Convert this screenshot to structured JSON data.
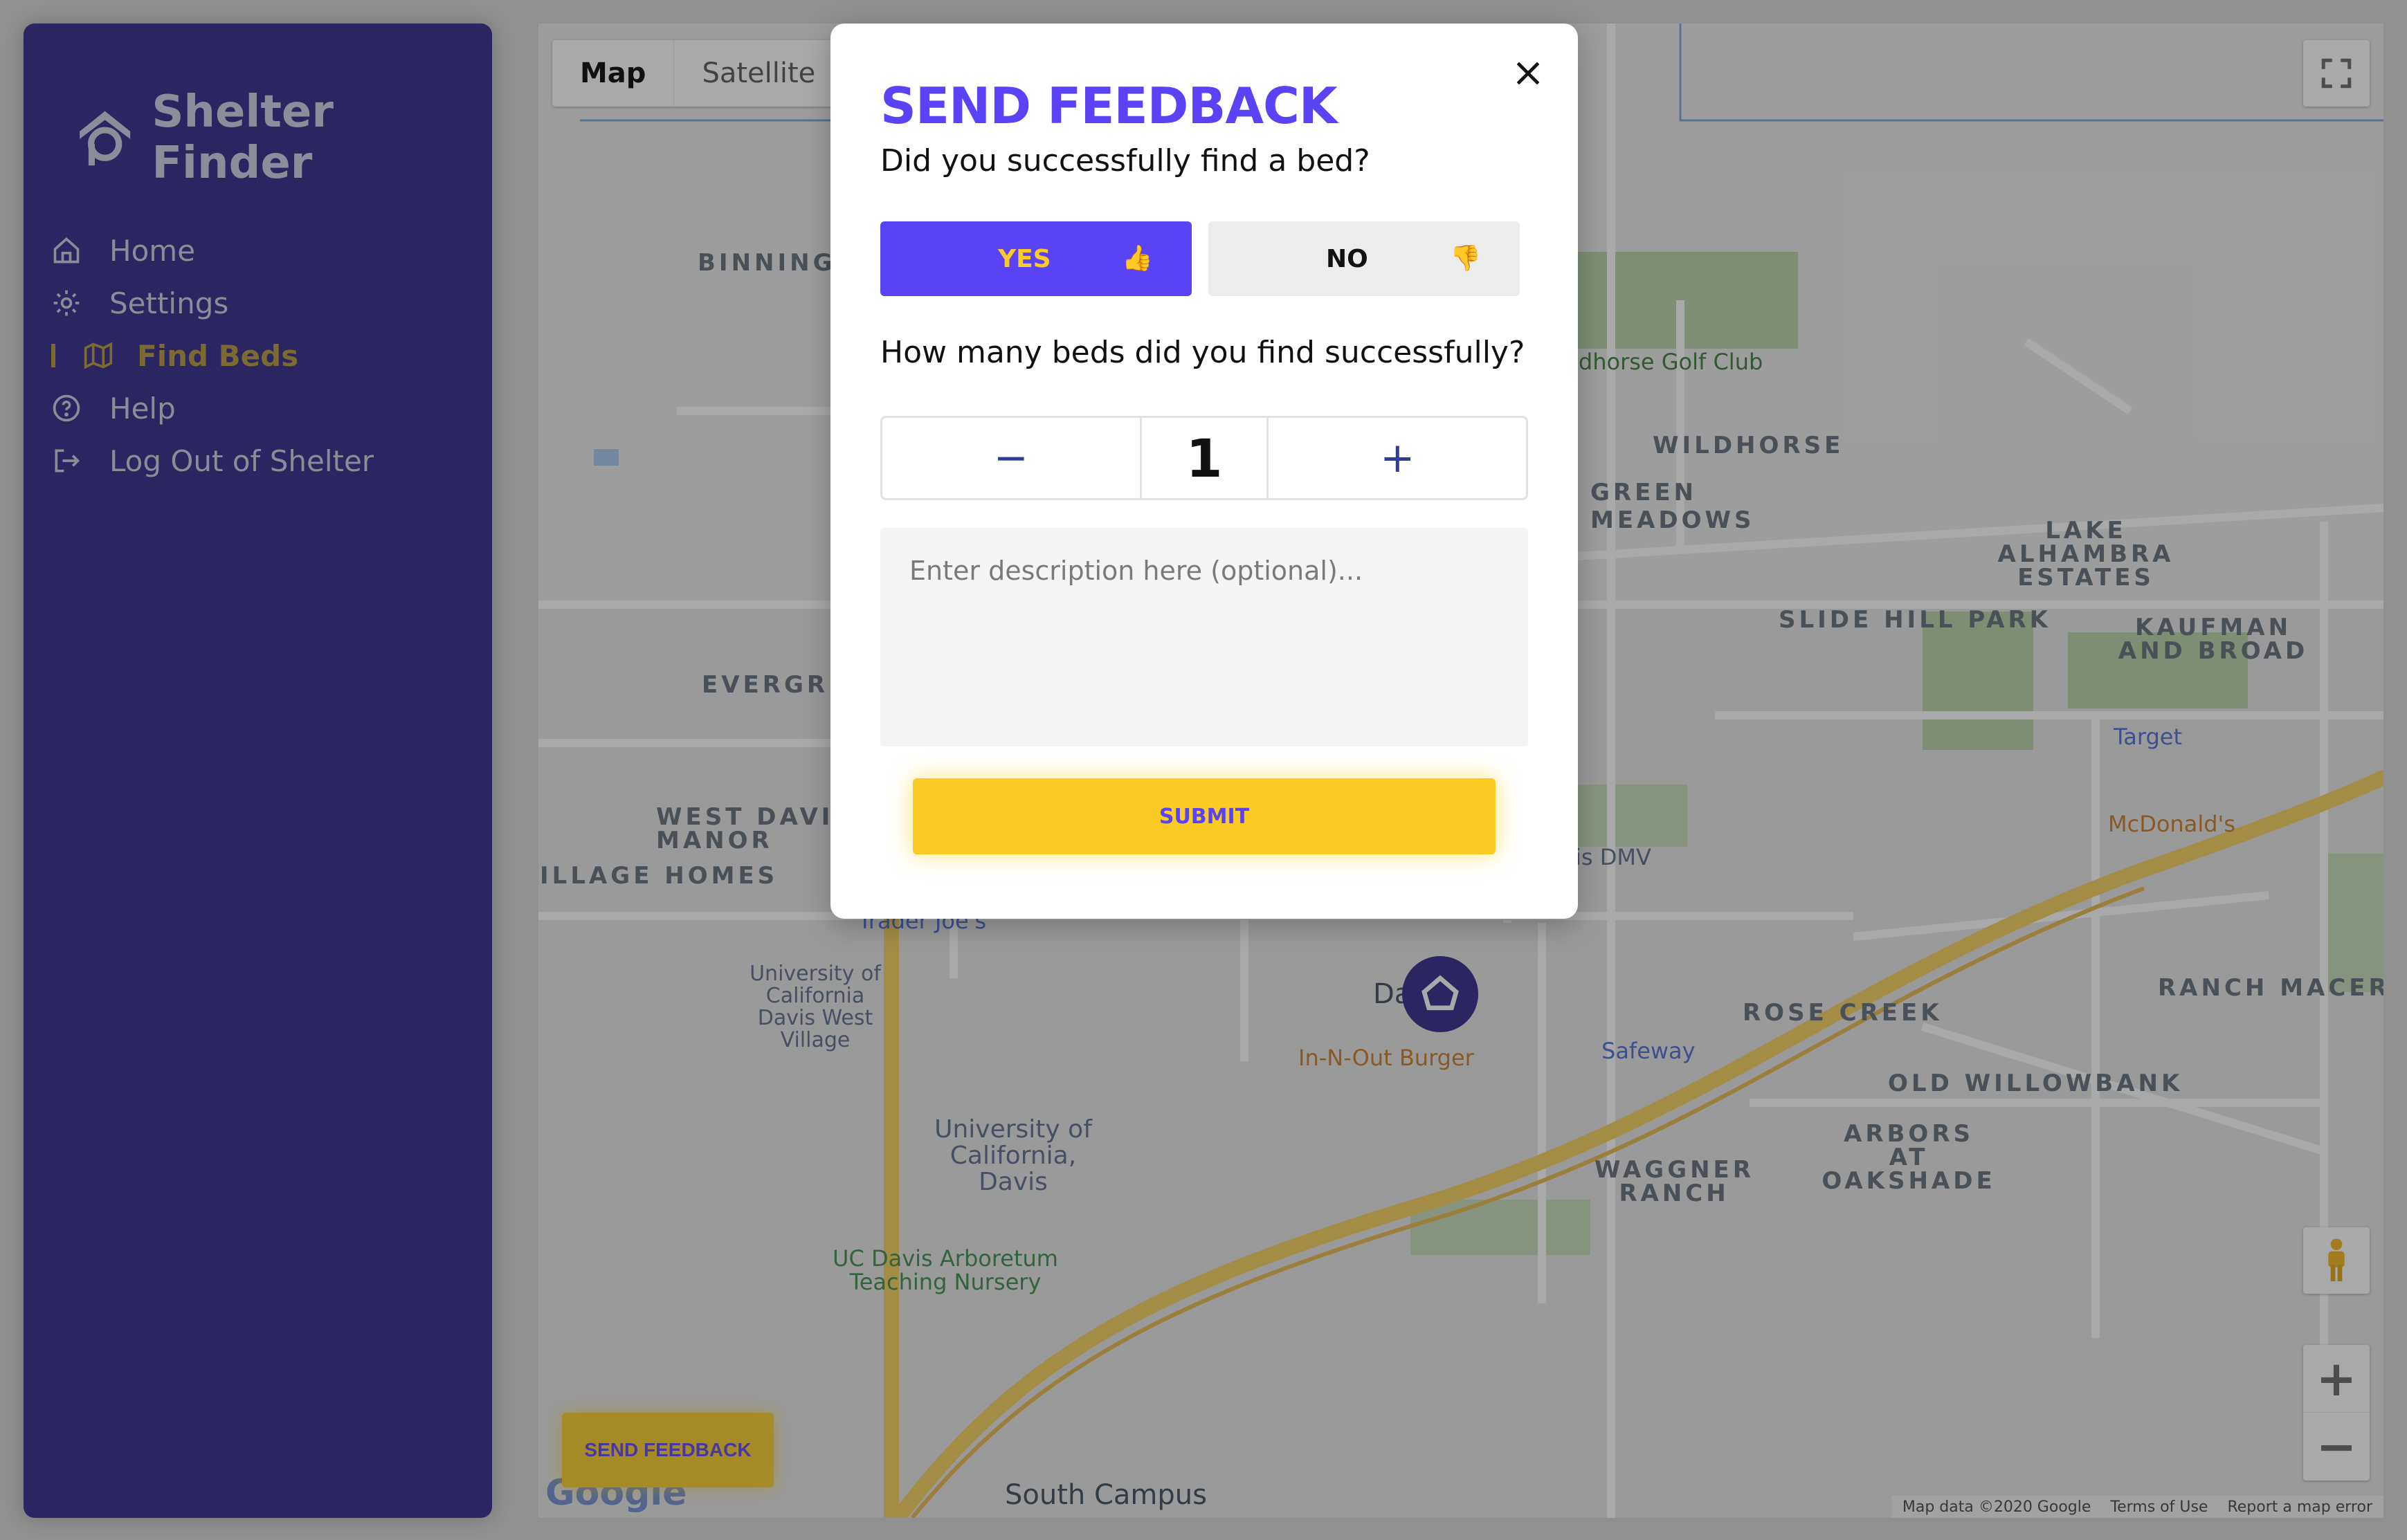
{
  "colors": {
    "sidebar_bg": "#2d2388",
    "accent_purple": "#5a43f5",
    "accent_yellow": "#f9cb24",
    "active_nav": "#b3973a",
    "nav_text": "#cfcfe0"
  },
  "sidebar": {
    "brand": "Shelter Finder",
    "items": [
      {
        "label": "Home",
        "icon": "home-icon"
      },
      {
        "label": "Settings",
        "icon": "gear-icon"
      },
      {
        "label": "Find Beds",
        "icon": "map-icon",
        "active": true
      },
      {
        "label": "Help",
        "icon": "help-icon"
      },
      {
        "label": "Log Out of Shelter",
        "icon": "logout-icon"
      }
    ]
  },
  "map": {
    "type_tabs": [
      "Map",
      "Satellite"
    ],
    "selected_type": "Map",
    "labels": {
      "binning": "BINNING",
      "wildhorse": "WILDHORSE",
      "green_meadows": "GREEN MEADOWS",
      "lake_alhambra": "LAKE ALHAMBRA ESTATES",
      "slide_hill": "SLIDE HILL PARK",
      "kaufman": "KAUFMAN AND BROAD",
      "evergreen": "EVERGRE",
      "west_davis": "WEST DAVIS MANOR",
      "village_homes": "ILLAGE HOMES",
      "rose_creek": "ROSE CREEK",
      "old_willowbank": "OLD WILLOWBANK",
      "arbors": "ARBORS AT OAKSHADE",
      "waggner": "WAGGNER RANCH",
      "ranch_macero": "RANCH MACERO"
    },
    "pois": {
      "golf": "ldhorse Golf Club",
      "target": "Target",
      "mcdonalds": "McDonald's",
      "dmv": "is DMV",
      "safeway": "Safeway",
      "in_n_out": "In-N-Out Burger",
      "trader_joes": "Trader Joe's",
      "uc_davis_west": "University of California Davis West Village",
      "uc_davis": "University of California, Davis",
      "arboretum": "UC Davis Arboretum Teaching Nursery",
      "south_campus": "South Campus",
      "davis": "Da"
    },
    "footer": {
      "data": "Map data ©2020 Google",
      "terms": "Terms of Use",
      "report": "Report a map error"
    },
    "logo": "Google"
  },
  "fab": {
    "label": "SEND FEEDBACK"
  },
  "modal": {
    "title": "SEND FEEDBACK",
    "question1": "Did you successfully find a bed?",
    "yes_label": "YES",
    "yes_emoji": "👍",
    "no_label": "NO",
    "no_emoji": "👎",
    "selected": "YES",
    "question2": "How many beds did you find successfully?",
    "count": "1",
    "minus": "−",
    "plus": "+",
    "description_placeholder": "Enter description here (optional)...",
    "submit_label": "SUBMIT"
  }
}
